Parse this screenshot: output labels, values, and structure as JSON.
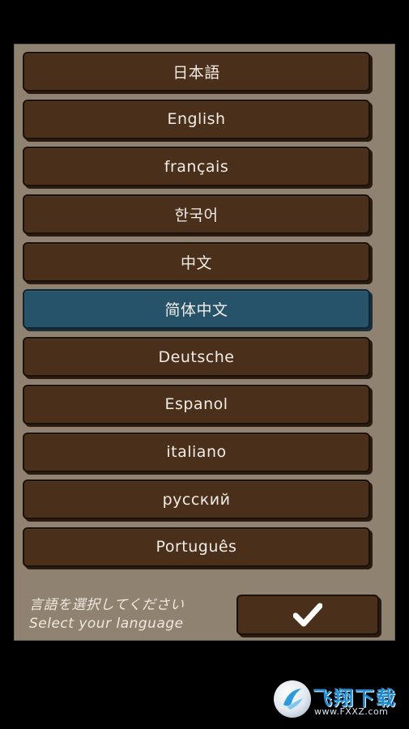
{
  "language_options": [
    {
      "label": "日本語",
      "selected": false
    },
    {
      "label": "English",
      "selected": false
    },
    {
      "label": "français",
      "selected": false
    },
    {
      "label": "한국어",
      "selected": false
    },
    {
      "label": "中文",
      "selected": false
    },
    {
      "label": "简体中文",
      "selected": true
    },
    {
      "label": "Deutsche",
      "selected": false
    },
    {
      "label": "Espanol",
      "selected": false
    },
    {
      "label": "italiano",
      "selected": false
    },
    {
      "label": "русский",
      "selected": false
    },
    {
      "label": "Português",
      "selected": false
    }
  ],
  "prompt": {
    "japanese": "言語を選択してください",
    "english": "Select your language"
  },
  "confirm": {
    "icon": "checkmark-icon"
  },
  "watermark": {
    "title": "飞翔下载",
    "url": "www.FXXZ.com"
  },
  "colors": {
    "panel": "#8f8270",
    "button": "#4a2f1a",
    "selected_button": "#265369",
    "text": "#f1ede6"
  }
}
